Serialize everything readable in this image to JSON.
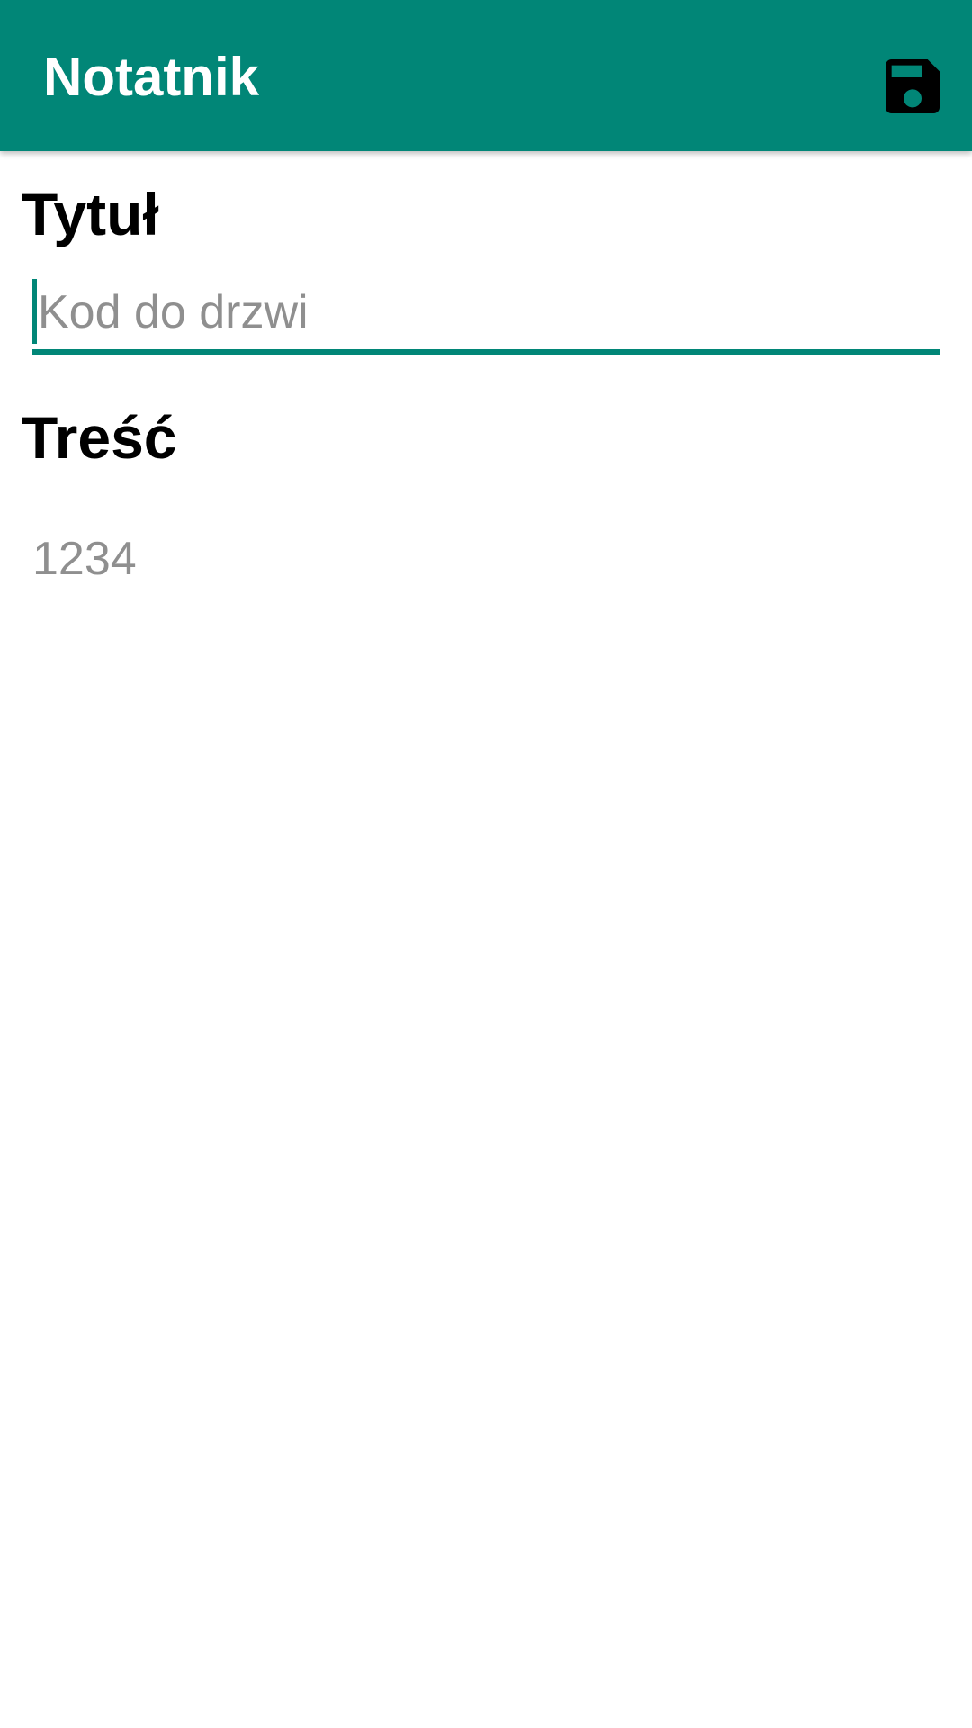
{
  "app": {
    "title": "Notatnik",
    "primary_color": "#018677",
    "actions": {
      "save_icon": "save-floppy-icon"
    }
  },
  "form": {
    "title_label": "Tytuł",
    "title_placeholder": "Kod do drzwi",
    "title_value": "",
    "content_label": "Treść",
    "content_placeholder": "1234",
    "content_value": ""
  }
}
